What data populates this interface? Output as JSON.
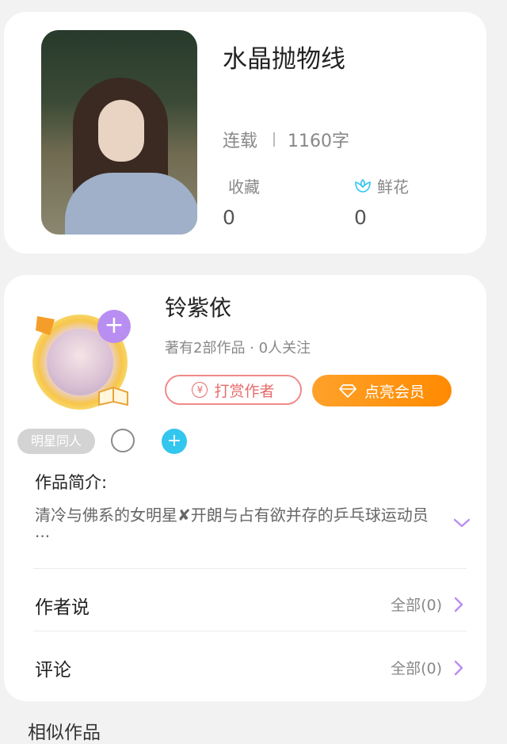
{
  "book": {
    "title": "水晶抛物线",
    "status": "连载",
    "word_count": "1160字",
    "favorites_label": "收藏",
    "favorites_value": "0",
    "flowers_label": "鲜花",
    "flowers_value": "0"
  },
  "author": {
    "name": "铃紫依",
    "meta": "著有2部作品 · 0人关注",
    "tip_label": "打赏作者",
    "vip_label": "点亮会员",
    "tag_label": "明星同人",
    "add_symbol": "+"
  },
  "intro": {
    "title": "作品简介:",
    "text": "清冷与佛系的女明星✘开朗与占有欲并存的乒乓球运动员···"
  },
  "rows": {
    "author_says_label": "作者说",
    "author_says_count": "全部(0)",
    "comments_label": "评论",
    "comments_count": "全部(0)"
  },
  "similar_title": "相似作品",
  "colors": {
    "accent_purple": "#b98ef2",
    "accent_orange": "#ff8a00",
    "accent_blue": "#33c6ef",
    "tip_red": "#e66c6c"
  },
  "icons": {
    "flower": "flower-icon",
    "yen": "yen-icon",
    "diamond": "diamond-icon",
    "chevron_down": "chevron-down-icon",
    "chevron_right": "chevron-right-icon"
  }
}
